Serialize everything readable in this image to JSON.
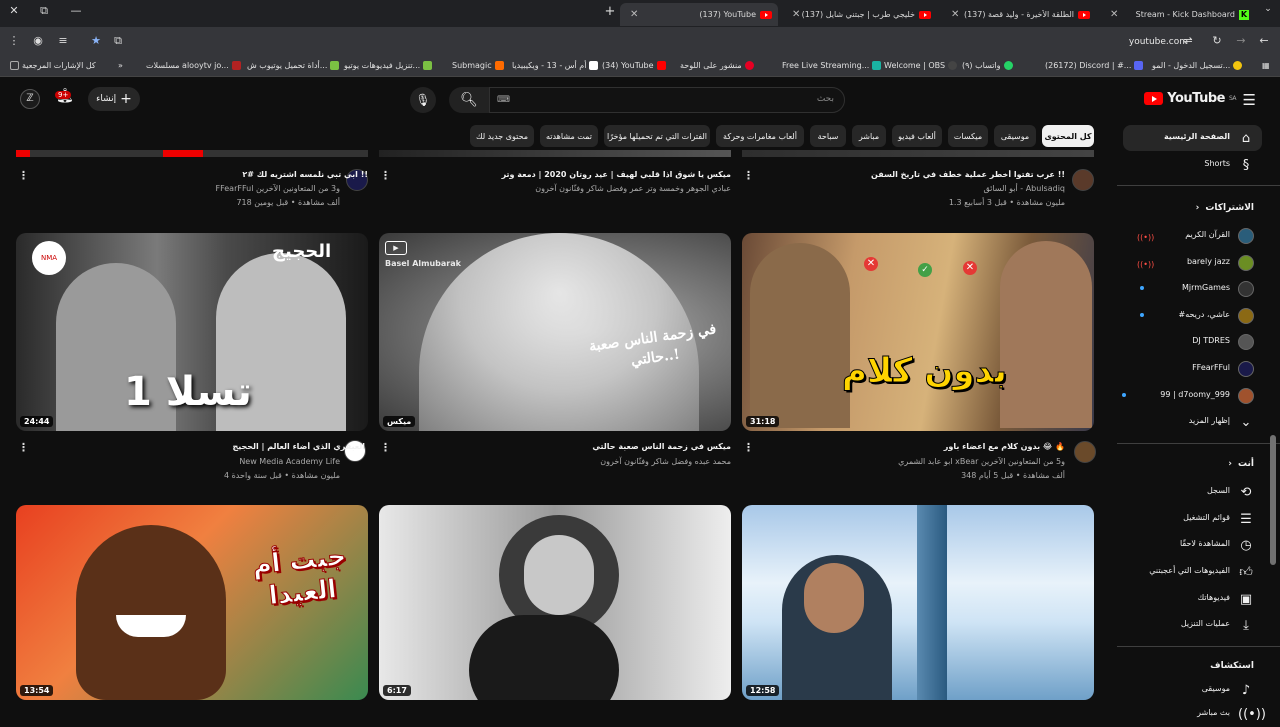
{
  "browser": {
    "tabs": [
      {
        "title": "Stream - Kick Dashboard",
        "icon": "kick-icon"
      },
      {
        "title": "(137) الطلقة الأخيرة - وليد قصة",
        "icon": "youtube-icon"
      },
      {
        "title": "(137) خليجي طرب | جبتني شايل",
        "icon": "youtube-icon"
      },
      {
        "title": "(137) YouTube",
        "icon": "youtube-icon",
        "active": true
      }
    ],
    "url": "youtube.com",
    "bookmarks": [
      {
        "label": "تسجيل الدخول - المو...",
        "color": "#f1c40f"
      },
      {
        "label": "(26172) Discord | #...",
        "color": "#5865f2"
      },
      {
        "label": "Welcome | OBS",
        "color": "#444444"
      },
      {
        "label": "(٩) واتساب",
        "color": "#25d366"
      },
      {
        "label": "Free Live Streaming...",
        "color": "#1ab4a3"
      },
      {
        "label": "منشور على اللوحة",
        "color": "#e60023"
      },
      {
        "label": "(34) YouTube",
        "color": "#ff0000"
      },
      {
        "label": "أم أس - 13 - ويكيبيديا",
        "color": "#ffffff"
      },
      {
        "label": "Submagic",
        "color": "#ff6b00"
      },
      {
        "label": "تنزيل فيديوهات يوتيو...",
        "color": "#7bc043"
      },
      {
        "label": "أداة تحميل يوتيوب ش...",
        "color": "#7bc043"
      },
      {
        "label": "مسلسلات alooytv jo...",
        "color": "#b22222"
      },
      {
        "label": "كل الإشارات المرجعية",
        "color": "#666666"
      }
    ]
  },
  "youtube": {
    "logo": "YouTube",
    "region": "SA",
    "search_placeholder": "بحث",
    "create_label": "إنشاء",
    "notif_count": "9+",
    "chips": [
      "كل المحتوى",
      "موسيقى",
      "ميكسات",
      "ألعاب فيديو",
      "مباشر",
      "سباحة",
      "ألعاب مغامرات وحركة",
      "الفترات التي تم تحميلها مؤخرًا",
      "تمت مشاهدته",
      "محتوى جديد لك"
    ],
    "sidebar": {
      "home": "الصفحة الرئيسية",
      "shorts": "Shorts",
      "subscriptions_title": "الاشتراكات",
      "subscriptions": [
        {
          "name": "القرآن الكريم",
          "status": "live",
          "color": "#2a5d7a"
        },
        {
          "name": "barely jazz",
          "status": "live",
          "color": "#6b8e23"
        },
        {
          "name": "MjrmGames",
          "status": "dot",
          "color": "#333333"
        },
        {
          "name": "#عاشي، دريحه",
          "status": "dot",
          "color": "#8b6914"
        },
        {
          "name": "DJ TDRES",
          "status": "",
          "color": "#555555"
        },
        {
          "name": "FFearFFul",
          "status": "",
          "color": "#1a1a4a"
        },
        {
          "name": "99 | d7oomy_999",
          "status": "dot",
          "color": "#a0522d"
        }
      ],
      "show_more": "إظهار المزيد",
      "you_title": "أنت",
      "you_items": [
        {
          "label": "السجل",
          "icon": "history-icon"
        },
        {
          "label": "قوائم التشغيل",
          "icon": "playlists-icon"
        },
        {
          "label": "المشاهدة لاحقًا",
          "icon": "watch-later-icon"
        },
        {
          "label": "الفيديوهات التي أعجبتني",
          "icon": "like-icon"
        },
        {
          "label": "فيديوهاتك",
          "icon": "your-videos-icon"
        },
        {
          "label": "عمليات التنزيل",
          "icon": "download-icon"
        }
      ],
      "explore_title": "استكشاف",
      "explore_items": [
        {
          "label": "موسيقى",
          "icon": "music-icon"
        },
        {
          "label": "بث مباشر",
          "icon": "live-icon"
        }
      ]
    },
    "videos_top": [
      {
        "title": "عرب تفتوا أخطر عملية خطف في تاريخ السفن !!",
        "channel": "أبو السائق - Abulsadiq",
        "meta": "1.3 مليون مشاهدة • قبل 3 أسابيع"
      },
      {
        "title": "ميكس يا شوق اذا قلبي لهيف | عيد روتان 2020 | دمعة وتر",
        "channel": "عبادي الجوهر وخمسة وتر عمر وفضل شاكر وفنّانون آخرون",
        "meta": ""
      },
      {
        "title": "ابي تبي نلمسه اشتريه لك #٢ !!",
        "channel": "FFearFFul و3 من المتعاونين الآخرين",
        "meta": "718 ألف مشاهدة • قبل يومين"
      }
    ],
    "videos_mid": [
      {
        "title": "بدون كلام مع اعضاء باور 😂 🔥",
        "channel": "ابو عابد الشمري xBear و5 من المتعاونين الآخرين",
        "meta": "348 ألف مشاهدة • قبل 5 أيام",
        "duration": "31:18",
        "overlay": "بدون كلام"
      },
      {
        "title": "ميكس في زحمة الناس صعبة حالتي",
        "channel": "محمد عبده وفضل شاكر وفنّانون آخرون",
        "meta": "",
        "duration": "ميكس",
        "overlay": "في زحمة الناس صعبة حالتي..!",
        "watermark": "Basel Almubarak"
      },
      {
        "title": "العبقري الذي أضاء العالم | الحجيج",
        "channel": "New Media Academy Life",
        "meta": "4 مليون مشاهدة • قبل سنة واحدة",
        "duration": "24:44",
        "overlay": "تسلا 1",
        "overlay2": "الحجيج"
      }
    ],
    "videos_bottom": [
      {
        "duration": "12:58"
      },
      {
        "duration": "6:17"
      },
      {
        "duration": "13:54",
        "overlay": "جبت أم العيدا"
      }
    ]
  }
}
